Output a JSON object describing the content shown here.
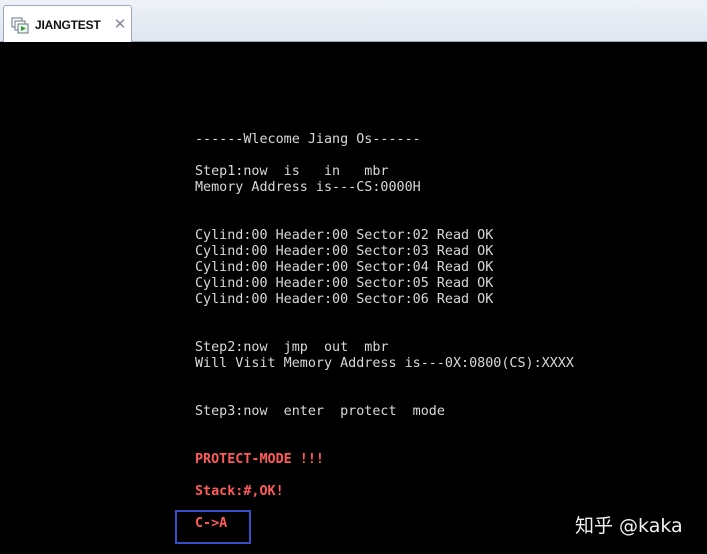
{
  "tab": {
    "title": "JIANGTEST",
    "close_glyph": "✕",
    "icon": "vm-window-icon"
  },
  "console": {
    "lines": [
      "------Wlecome Jiang Os------",
      "Step1:now  is   in   mbr",
      "Memory Address is---CS:0000H",
      "Cylind:00 Header:00 Sector:02 Read OK",
      "Cylind:00 Header:00 Sector:03 Read OK",
      "Cylind:00 Header:00 Sector:04 Read OK",
      "Cylind:00 Header:00 Sector:05 Read OK",
      "Cylind:00 Header:00 Sector:06 Read OK",
      "Step2:now  jmp  out  mbr",
      "Will Visit Memory Address is---0X:0800(CS):XXXX",
      "Step3:now  enter  protect  mode",
      "PROTECT-MODE !!!",
      "Stack:#,OK!",
      "C->A"
    ]
  },
  "colors": {
    "screen_bg": "#000000",
    "text": "#d8d8d8",
    "alert": "#ff5a5a",
    "highlight_box": "#3450c8"
  },
  "watermark": "知乎 @kaka"
}
